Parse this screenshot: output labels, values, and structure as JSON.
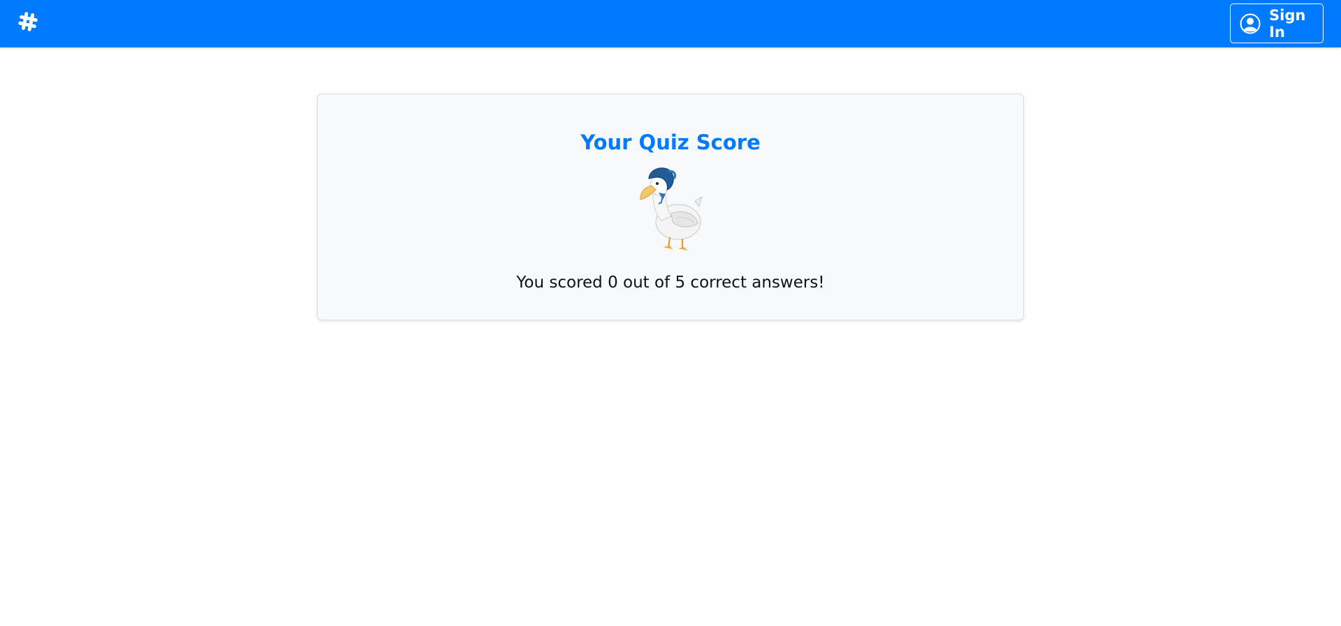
{
  "navbar": {
    "background_color": "#007bff",
    "brand_icon": "hashtag-icon",
    "signin": {
      "icon": "user-circle-icon",
      "label": "Sign In"
    }
  },
  "score_card": {
    "title": "Your Quiz Score",
    "title_color": "#007bff",
    "illustration": "duck-with-bonnet-image",
    "score_text": "You scored 0 out of 5 correct answers!"
  }
}
